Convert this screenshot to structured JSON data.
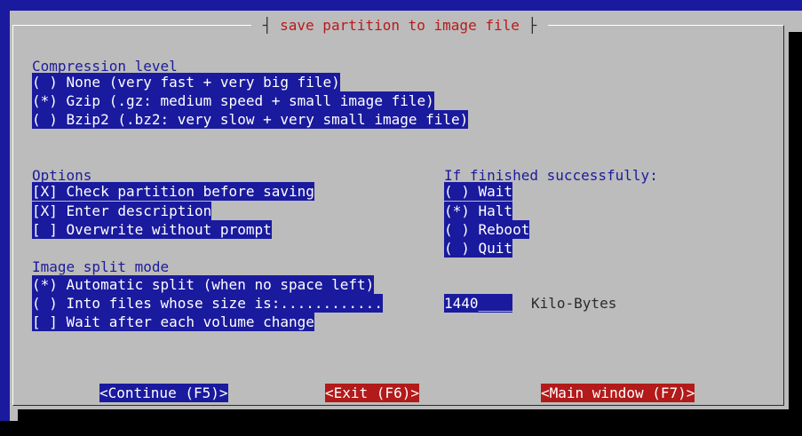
{
  "dialog": {
    "title": "save partition to image file"
  },
  "compression": {
    "heading": "Compression level",
    "options": [
      "( ) None (very fast + very big file)",
      "(*) Gzip (.gz: medium speed + small image file)",
      "( ) Bzip2 (.bz2: very slow + very small image file)"
    ]
  },
  "options": {
    "heading": "Options",
    "items": [
      "[X] Check partition before saving",
      "[X] Enter description",
      "[ ] Overwrite without prompt"
    ]
  },
  "finished": {
    "heading": "If finished successfully:",
    "items": [
      "( ) Wait",
      "(*) Halt",
      "( ) Reboot",
      "( ) Quit"
    ]
  },
  "split": {
    "heading": "Image split mode",
    "items": [
      "(*) Automatic split (when no space left)",
      "( ) Into files whose size is:............",
      "[ ] Wait after each volume change"
    ],
    "size_value": "1440____",
    "size_unit": "Kilo-Bytes"
  },
  "buttons": {
    "continue": "<Continue (F5)>",
    "exit": "<Exit (F6)>",
    "main_window": "<Main window (F7)>"
  },
  "colors": {
    "background": "#bcbcbc",
    "highlight": "#1a1a9e",
    "danger": "#b31a1a",
    "title": "#b81a1a"
  }
}
